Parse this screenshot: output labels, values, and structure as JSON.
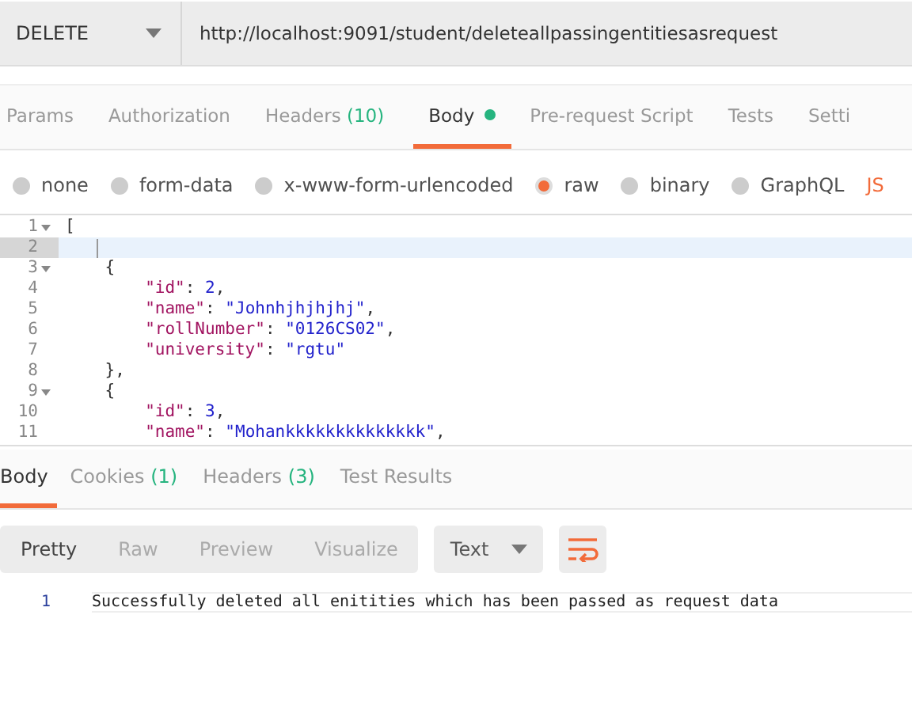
{
  "request": {
    "method": "DELETE",
    "url": "http://localhost:9091/student/deleteallpassingentitiesasrequest"
  },
  "request_tabs": [
    {
      "label": "Params",
      "selected": false
    },
    {
      "label": "Authorization",
      "selected": false
    },
    {
      "label": "Headers",
      "count": "(10)",
      "selected": false
    },
    {
      "label": "Body",
      "dot": true,
      "selected": true
    },
    {
      "label": "Pre-request Script",
      "selected": false
    },
    {
      "label": "Tests",
      "selected": false
    },
    {
      "label": "Setti",
      "selected": false
    }
  ],
  "body_types": [
    {
      "label": "none",
      "selected": false
    },
    {
      "label": "form-data",
      "selected": false
    },
    {
      "label": "x-www-form-urlencoded",
      "selected": false
    },
    {
      "label": "raw",
      "selected": true
    },
    {
      "label": "binary",
      "selected": false
    },
    {
      "label": "GraphQL",
      "selected": false
    }
  ],
  "format_label": "JS",
  "editor": {
    "lines": [
      {
        "number": "1",
        "text": "[",
        "foldable": true,
        "active": false
      },
      {
        "number": "2",
        "foldable": false,
        "active": true
      },
      {
        "number": "3",
        "text": "    {",
        "foldable": true,
        "active": false
      },
      {
        "number": "4",
        "text": "        \"id\": 2,",
        "foldable": false,
        "active": false
      },
      {
        "number": "5",
        "text": "        \"name\": \"Johnhjhjhjhj\",",
        "foldable": false,
        "active": false
      },
      {
        "number": "6",
        "text": "        \"rollNumber\": \"0126CS02\",",
        "foldable": false,
        "active": false
      },
      {
        "number": "7",
        "text": "        \"university\": \"rgtu\"",
        "foldable": false,
        "active": false
      },
      {
        "number": "8",
        "text": "    },",
        "foldable": false,
        "active": false
      },
      {
        "number": "9",
        "text": "    {",
        "foldable": true,
        "active": false
      },
      {
        "number": "10",
        "text": "        \"id\": 3,",
        "foldable": false,
        "active": false
      },
      {
        "number": "11",
        "text": "        \"name\": \"Mohankkkkkkkkkkkkkk\",",
        "foldable": false,
        "active": false
      }
    ]
  },
  "response_tabs": [
    {
      "label": "Body",
      "selected": true
    },
    {
      "label": "Cookies",
      "count": "(1)",
      "selected": false
    },
    {
      "label": "Headers",
      "count": "(3)",
      "selected": false
    },
    {
      "label": "Test Results",
      "selected": false
    }
  ],
  "view_modes": [
    {
      "label": "Pretty",
      "selected": true
    },
    {
      "label": "Raw",
      "selected": false
    },
    {
      "label": "Preview",
      "selected": false
    },
    {
      "label": "Visualize",
      "selected": false
    }
  ],
  "response_format": "Text",
  "wrap_lines": true,
  "response_lines": [
    {
      "number": "1",
      "text": "Successfully deleted all enitities which has been passed as request data"
    }
  ]
}
